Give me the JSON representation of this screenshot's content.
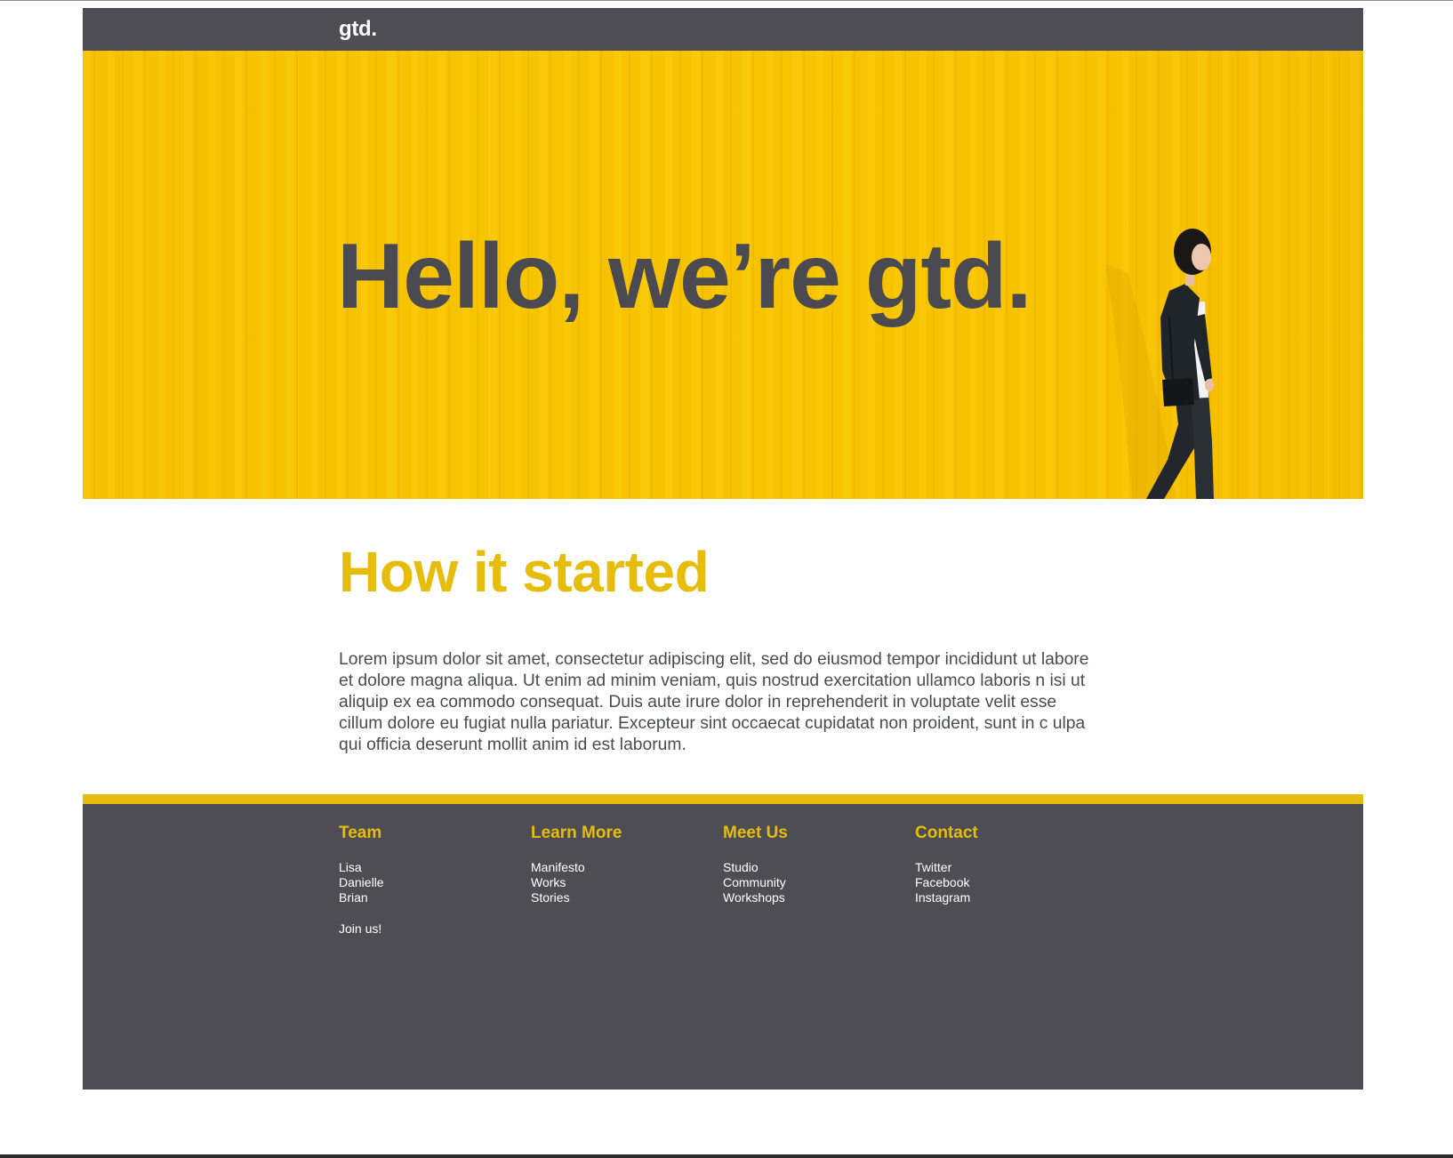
{
  "header": {
    "logo": "gtd."
  },
  "hero": {
    "title": "Hello, we’re gtd."
  },
  "about": {
    "title": "How it started",
    "text": "Lorem ipsum dolor sit amet, consectetur adipiscing elit, sed do eiusmod tempor incididunt ut labore et dolore magna aliqua. Ut enim ad minim veniam, quis nostrud exercitation ullamco laboris n isi ut aliquip ex ea commodo consequat. Duis aute irure dolor in reprehenderit in voluptate velit esse cillum dolore eu fugiat nulla pariatur. Excepteur sint occaecat cupidatat non proident, sunt in c ulpa qui officia deserunt mollit anim id est laborum."
  },
  "footer": {
    "columns": [
      {
        "title": "Team",
        "items": [
          "Lisa",
          "Danielle",
          "Brian"
        ],
        "extra": "Join us!"
      },
      {
        "title": "Learn More",
        "items": [
          "Manifesto",
          "Works",
          "Stories"
        ]
      },
      {
        "title": "Meet Us",
        "items": [
          "Studio",
          "Community",
          "Workshops"
        ]
      },
      {
        "title": "Contact",
        "items": [
          "Twitter",
          "Facebook",
          "Instagram"
        ]
      }
    ]
  },
  "colors": {
    "dark": "#4f4d54",
    "accent_yellow": "#e6bd0c",
    "hero_yellow": "#f7c400"
  }
}
